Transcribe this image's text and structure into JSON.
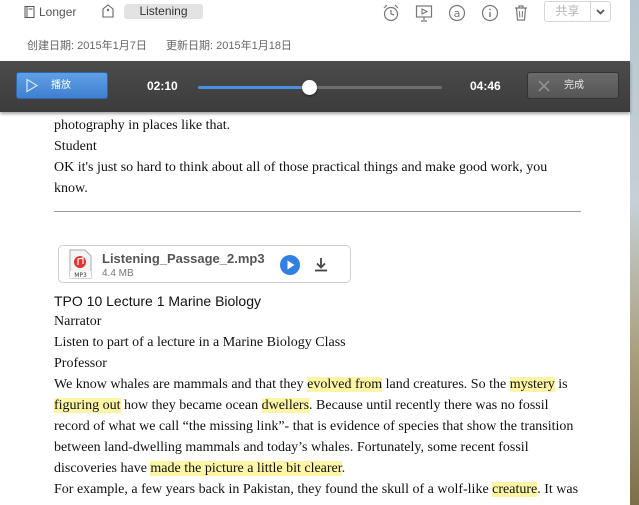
{
  "header": {
    "notebook_label": "Longer",
    "tag_label": "Listening",
    "share_label": "共享",
    "created": "创建日期: 2015年1月7日",
    "updated": "更新日期: 2015年1月18日",
    "toolbar_icons": [
      "alarm-icon",
      "present-icon",
      "at-icon",
      "info-icon",
      "trash-icon"
    ]
  },
  "player": {
    "play_label": "播放",
    "elapsed": "02:10",
    "total": "04:46",
    "progress": 0.4545,
    "done_label": "完成",
    "accent": "#4a90e2"
  },
  "document": {
    "lines_top": [
      "photography in places like that.",
      "Student",
      "OK it's just so hard to think about all of those practical things and make good work, you",
      "know."
    ],
    "attachment": {
      "name": "Listening_Passage_2.mp3",
      "size": "4.4 MB",
      "type_badge": "MP3"
    },
    "lecture_title": "TPO 10 Lecture 1 Marine Biology",
    "narrator": "Narrator",
    "intro": "Listen to part of a lecture in a Marine Biology Class",
    "professor": "Professor",
    "p1": [
      {
        "t": "We know whales are mammals and that they "
      },
      {
        "t": "evolved from",
        "hl": true
      },
      {
        "t": " land creatures. So the "
      },
      {
        "t": "mystery",
        "hl": true
      },
      {
        "t": " is"
      }
    ],
    "p2": [
      {
        "t": "figuring out",
        "hl": true
      },
      {
        "t": " how they became ocean "
      },
      {
        "t": "dwellers",
        "hl": true
      },
      {
        "t": ". Because until recently there was no fossil"
      }
    ],
    "p3": "record of what we call “the missing link”- that is evidence of species that show the transition",
    "p4": "between land-dwelling mammals and today’s whales. Fortunately, some recent fossil",
    "p5": [
      {
        "t": "discoveries have "
      },
      {
        "t": "made the picture a little bit clearer",
        "hl": true
      },
      {
        "t": "."
      }
    ],
    "p6": [
      {
        "t": "For example, a few years back in Pakistan, they found the skull of a wolf-like "
      },
      {
        "t": "creature",
        "hl": true
      },
      {
        "t": ". It was"
      }
    ],
    "highlight_color": "#fdf5a6"
  }
}
